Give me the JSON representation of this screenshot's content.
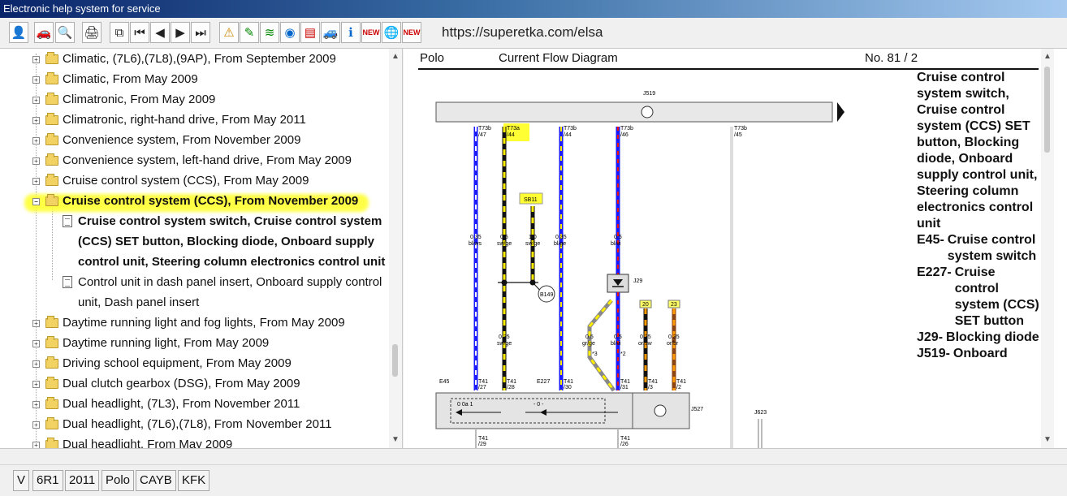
{
  "window": {
    "title": "Electronic help system for service"
  },
  "toolbar": {
    "url": "https://superetka.com/elsa",
    "buttons": [
      "user-icon",
      "car-icon",
      "search-icon",
      "print-icon",
      "copy-icon",
      "first-page-icon",
      "prev-page-icon",
      "next-page-icon",
      "last-page-icon",
      "warning-icon",
      "repair-icon",
      "wiring-icon",
      "view-icon",
      "book-icon",
      "car-service-icon",
      "car-info-icon",
      "new-icon",
      "globe-icon",
      "new-list-icon"
    ]
  },
  "tree": {
    "items": [
      {
        "label": "Climatic, (7L6),(7L8),(9AP), From September 2009",
        "type": "folder"
      },
      {
        "label": "Climatic, From May 2009",
        "type": "folder"
      },
      {
        "label": "Climatronic, From May 2009",
        "type": "folder"
      },
      {
        "label": "Climatronic, right-hand drive, From May 2011",
        "type": "folder"
      },
      {
        "label": "Convenience system, From November 2009",
        "type": "folder"
      },
      {
        "label": "Convenience system, left-hand drive, From May 2009",
        "type": "folder"
      },
      {
        "label": "Cruise control system (CCS), From May 2009",
        "type": "folder"
      },
      {
        "label": "Cruise control system (CCS), From November 2009",
        "type": "folder-open"
      }
    ],
    "docs": [
      {
        "lines": [
          "Cruise control system switch, Cruise control system",
          "(CCS) SET button, Blocking diode, Onboard supply",
          "control unit, Steering column electronics control unit"
        ]
      },
      {
        "lines": [
          "Control unit in dash panel insert, Onboard supply control",
          "unit, Dash panel insert"
        ]
      }
    ],
    "items_after": [
      {
        "label": "Daytime running light and fog lights, From May 2009"
      },
      {
        "label": "Daytime running light, From May 2009"
      },
      {
        "label": "Driving school equipment, From May 2009"
      },
      {
        "label": "Dual clutch gearbox (DSG), From May 2009"
      },
      {
        "label": "Dual headlight, (7L3), From November 2011"
      },
      {
        "label": "Dual headlight, (7L6),(7L8), From November 2011"
      },
      {
        "label": "Dual headlight, From May 2009"
      }
    ],
    "highlight_color": "#ffff33"
  },
  "diagram": {
    "model": "Polo",
    "title": "Current Flow Diagram",
    "number": "No.  81 / 2",
    "legend_intro": "Cruise control system switch, Cruise control system (CCS) SET button, Blocking diode, Onboard supply control unit, Steering column electronics control unit",
    "legend": [
      {
        "code": "E45-",
        "desc": "Cruise control system switch"
      },
      {
        "code": "E227-",
        "desc": "Cruise control system (CCS) SET button"
      },
      {
        "code": "J29-",
        "desc": "Blocking diode"
      },
      {
        "code": "J519-",
        "desc": "Onboard"
      }
    ],
    "labels": {
      "j519": "J519",
      "sb11": "SB11",
      "b149": "B149",
      "j29": "J29",
      "e45": "E45",
      "e227": "E227",
      "j527": "J527",
      "j623": "J623",
      "c20": "20",
      "c23": "23",
      "star2": "*2",
      "star3": "*3",
      "pin_t73b_47": [
        "T73b",
        "/47"
      ],
      "pin_t73a_44": [
        "T73a",
        "/44"
      ],
      "pin_t73b_44": [
        "T73b",
        "/44"
      ],
      "pin_t73b_46": [
        "T73b",
        "/46"
      ],
      "pin_t73b_45": [
        "T73b",
        "/45"
      ],
      "wire_a": [
        "0.35",
        "bl/ws"
      ],
      "wire_b": [
        "0.5",
        "sw/ge"
      ],
      "wire_c": [
        "1.0",
        "sw/ge"
      ],
      "wire_d": [
        "0.35",
        "bl/ge"
      ],
      "wire_e": [
        "0.5",
        "bl/vi"
      ],
      "wire_f": [
        "0.35",
        "sw/ge"
      ],
      "wire_g": [
        "0.5",
        "gr/ge"
      ],
      "wire_h": [
        "0.5",
        "bl/vi"
      ],
      "wire_i": [
        "0.35",
        "or/sw"
      ],
      "wire_j": [
        "0.35",
        "or/br"
      ],
      "t41_27": [
        "T41",
        "/27"
      ],
      "t41_28": [
        "T41",
        "/28"
      ],
      "t41_30": [
        "T41",
        "/30"
      ],
      "t41_31": [
        "T41",
        "/31"
      ],
      "t41_3": [
        "T41",
        "/3"
      ],
      "t41_2": [
        "T41",
        "/2"
      ],
      "t41_29": [
        "T41",
        "/29"
      ],
      "t41_26": [
        "T41",
        "/26"
      ],
      "switch_0": "0 0a 1",
      "switch_1": "- 0 -"
    },
    "colors": {
      "blue": "#1a1aff",
      "yellow": "#ffee00",
      "black": "#111111",
      "red": "#ee1111",
      "orange": "#ff9900",
      "highlight": "#ffff33"
    }
  },
  "status": {
    "cells": [
      "V",
      "6R1",
      "2011",
      "Polo",
      "CAYB",
      "KFK"
    ]
  }
}
